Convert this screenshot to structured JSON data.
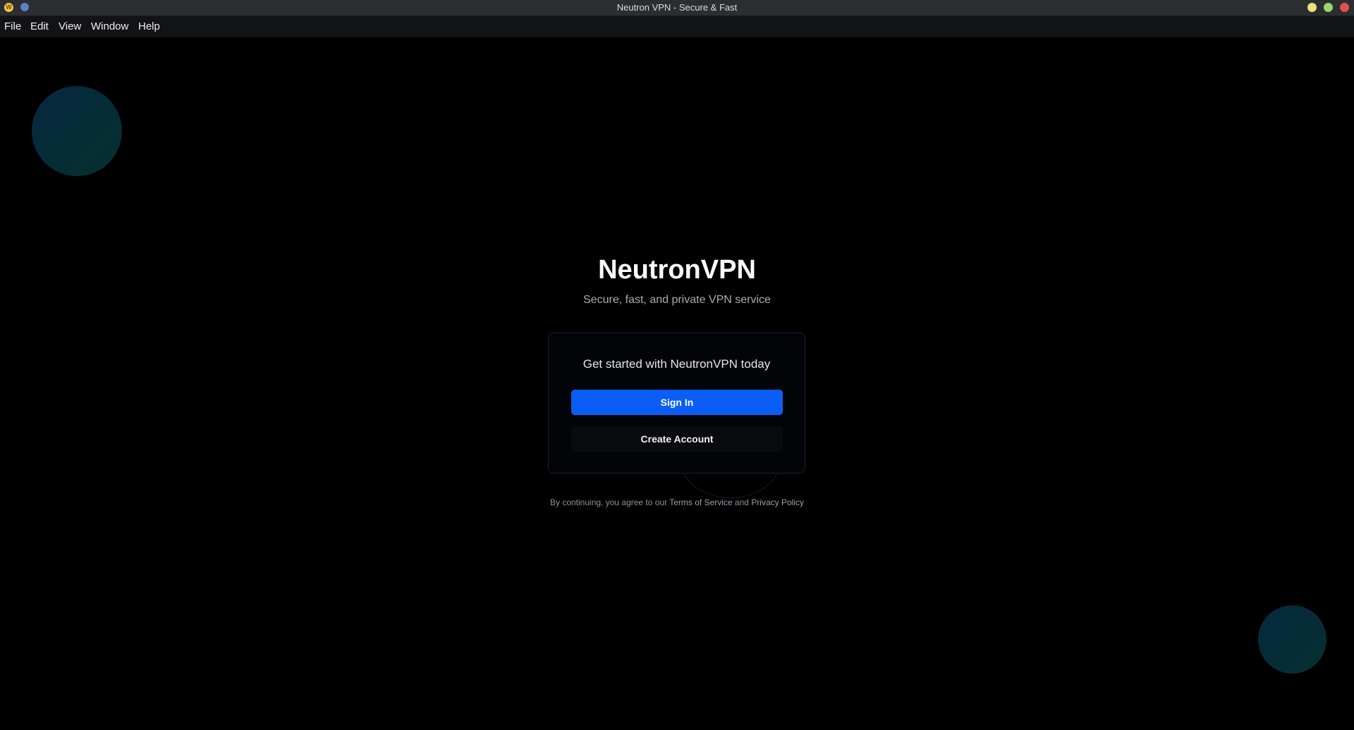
{
  "window": {
    "title": "Neutron VPN - Secure & Fast",
    "app_icon": "neutron-app-icon",
    "controls": [
      "minimize",
      "maximize",
      "close"
    ],
    "colors": {
      "minimize": "#e8e27a",
      "maximize": "#9ad66b",
      "close": "#e2514c"
    }
  },
  "menu": {
    "file": "File",
    "edit": "Edit",
    "view": "View",
    "window": "Window",
    "help": "Help"
  },
  "hero": {
    "brand": "NeutronVPN",
    "tagline": "Secure, fast, and private VPN service"
  },
  "card": {
    "heading": "Get started with NeutronVPN today",
    "sign_in_label": "Sign In",
    "create_account_label": "Create Account"
  },
  "legal": {
    "prefix": "By continuing, you agree to our ",
    "terms": "Terms of Service",
    "and": " and ",
    "privacy": "Privacy Policy"
  },
  "colors": {
    "background": "#000000",
    "accent": "#0a5df5",
    "card_border": "#12223c"
  }
}
